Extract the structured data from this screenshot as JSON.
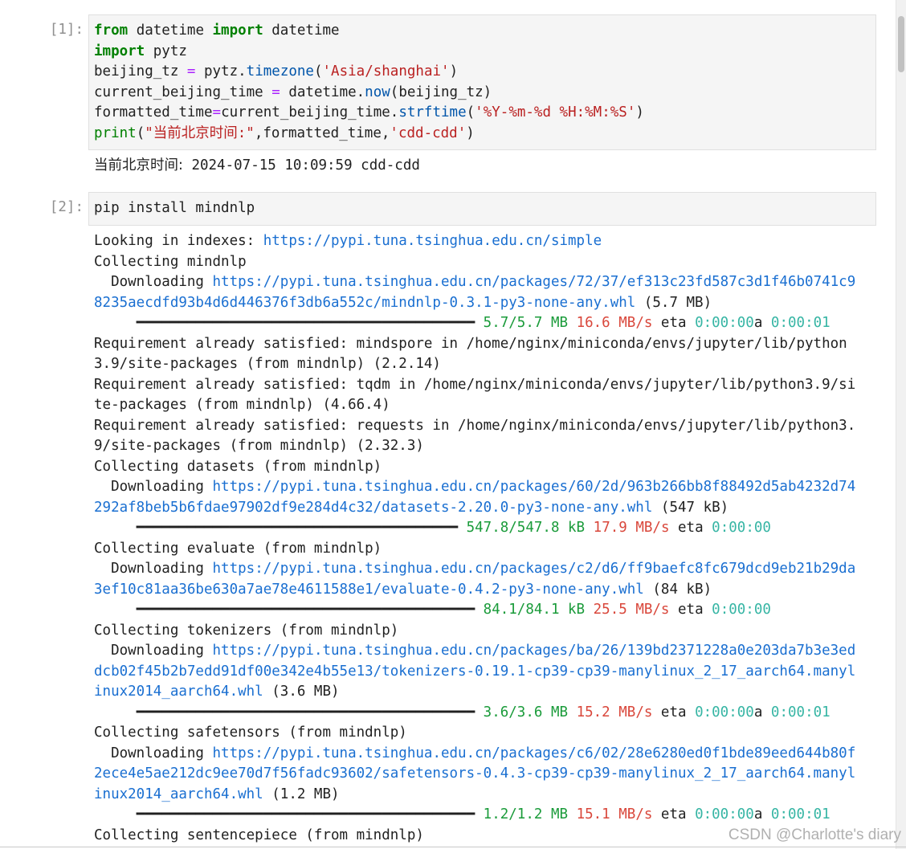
{
  "cells": [
    {
      "prompt": "[1]:",
      "code_lines": [
        [
          [
            "kw",
            "from"
          ],
          [
            "t",
            " datetime "
          ],
          [
            "kw",
            "import"
          ],
          [
            "t",
            " datetime"
          ]
        ],
        [
          [
            "kw",
            "import"
          ],
          [
            "t",
            " pytz"
          ]
        ],
        [
          [
            "t",
            "beijing_tz "
          ],
          [
            "op",
            "="
          ],
          [
            "t",
            " pytz."
          ],
          [
            "fn",
            "timezone"
          ],
          [
            "t",
            "("
          ],
          [
            "str",
            "'Asia/shanghai'"
          ],
          [
            "t",
            ")"
          ]
        ],
        [
          [
            "t",
            "current_beijing_time "
          ],
          [
            "op",
            "="
          ],
          [
            "t",
            " datetime."
          ],
          [
            "fn",
            "now"
          ],
          [
            "t",
            "(beijing_tz)"
          ]
        ],
        [
          [
            "t",
            "formatted_time"
          ],
          [
            "op",
            "="
          ],
          [
            "t",
            "current_beijing_time."
          ],
          [
            "fn",
            "strftime"
          ],
          [
            "t",
            "("
          ],
          [
            "str",
            "'%Y-%m-%d %H:%M:%S'"
          ],
          [
            "t",
            ")"
          ]
        ],
        [
          [
            "builtin",
            "print"
          ],
          [
            "t",
            "("
          ],
          [
            "str",
            "\"当前北京时间:\""
          ],
          [
            "t",
            ",formatted_time,"
          ],
          [
            "str",
            "'cdd-cdd'"
          ],
          [
            "t",
            ")"
          ]
        ]
      ],
      "output_lines": [
        [
          [
            "cjk",
            "当前北京时间:"
          ],
          [
            "t",
            " 2024-07-15 10:09:59 cdd-cdd"
          ]
        ]
      ]
    },
    {
      "prompt": "[2]:",
      "code_lines": [
        [
          [
            "t",
            "pip install mindnlp"
          ]
        ]
      ],
      "output_lines": [
        [
          [
            "t",
            "Looking in indexes: "
          ],
          [
            "link",
            "https://pypi.tuna.tsinghua.edu.cn/simple"
          ]
        ],
        [
          [
            "t",
            "Collecting mindnlp"
          ]
        ],
        [
          [
            "t",
            "  Downloading "
          ],
          [
            "link",
            "https://pypi.tuna.tsinghua.edu.cn/packages/72/37/ef313c23fd587c3d1f46b0741c9"
          ]
        ],
        [
          [
            "link",
            "8235aecdfd93b4d6d446376f3db6a552c/mindnlp-0.3.1-py3-none-any.whl"
          ],
          [
            "t",
            " (5.7 MB)"
          ]
        ],
        [
          [
            "bar",
            "     ━━━━━━━━━━━━━━━━━━━━━━━━━━━━━━━━━━━━━━━━ "
          ],
          [
            "green",
            "5.7/5.7 MB"
          ],
          [
            "t",
            " "
          ],
          [
            "red",
            "16.6 MB/s"
          ],
          [
            "t",
            " eta "
          ],
          [
            "cyan",
            "0:00:00"
          ],
          [
            "t",
            "a "
          ],
          [
            "cyan",
            "0:00:01"
          ]
        ],
        [
          [
            "t",
            "Requirement already satisfied: mindspore in /home/nginx/miniconda/envs/jupyter/lib/python"
          ]
        ],
        [
          [
            "t",
            "3.9/site-packages (from mindnlp) (2.2.14)"
          ]
        ],
        [
          [
            "t",
            "Requirement already satisfied: tqdm in /home/nginx/miniconda/envs/jupyter/lib/python3.9/si"
          ]
        ],
        [
          [
            "t",
            "te-packages (from mindnlp) (4.66.4)"
          ]
        ],
        [
          [
            "t",
            "Requirement already satisfied: requests in /home/nginx/miniconda/envs/jupyter/lib/python3."
          ]
        ],
        [
          [
            "t",
            "9/site-packages (from mindnlp) (2.32.3)"
          ]
        ],
        [
          [
            "t",
            "Collecting datasets (from mindnlp)"
          ]
        ],
        [
          [
            "t",
            "  Downloading "
          ],
          [
            "link",
            "https://pypi.tuna.tsinghua.edu.cn/packages/60/2d/963b266bb8f88492d5ab4232d74"
          ]
        ],
        [
          [
            "link",
            "292af8beb5b6fdae97902df9e284d4c32/datasets-2.20.0-py3-none-any.whl"
          ],
          [
            "t",
            " (547 kB)"
          ]
        ],
        [
          [
            "bar",
            "     ━━━━━━━━━━━━━━━━━━━━━━━━━━━━━━━━━━━━━━ "
          ],
          [
            "green",
            "547.8/547.8 kB"
          ],
          [
            "t",
            " "
          ],
          [
            "red",
            "17.9 MB/s"
          ],
          [
            "t",
            " eta "
          ],
          [
            "cyan",
            "0:00:00"
          ]
        ],
        [
          [
            "t",
            "Collecting evaluate (from mindnlp)"
          ]
        ],
        [
          [
            "t",
            "  Downloading "
          ],
          [
            "link",
            "https://pypi.tuna.tsinghua.edu.cn/packages/c2/d6/ff9baefc8fc679dcd9eb21b29da"
          ]
        ],
        [
          [
            "link",
            "3ef10c81aa36be630a7ae78e4611588e1/evaluate-0.4.2-py3-none-any.whl"
          ],
          [
            "t",
            " (84 kB)"
          ]
        ],
        [
          [
            "bar",
            "     ━━━━━━━━━━━━━━━━━━━━━━━━━━━━━━━━━━━━━━━━ "
          ],
          [
            "green",
            "84.1/84.1 kB"
          ],
          [
            "t",
            " "
          ],
          [
            "red",
            "25.5 MB/s"
          ],
          [
            "t",
            " eta "
          ],
          [
            "cyan",
            "0:00:00"
          ]
        ],
        [
          [
            "t",
            "Collecting tokenizers (from mindnlp)"
          ]
        ],
        [
          [
            "t",
            "  Downloading "
          ],
          [
            "link",
            "https://pypi.tuna.tsinghua.edu.cn/packages/ba/26/139bd2371228a0e203da7b3e3ed"
          ]
        ],
        [
          [
            "link",
            "dcb02f45b2b7edd91df00e342e4b55e13/tokenizers-0.19.1-cp39-cp39-manylinux_2_17_aarch64.manyl"
          ]
        ],
        [
          [
            "link",
            "inux2014_aarch64.whl"
          ],
          [
            "t",
            " (3.6 MB)"
          ]
        ],
        [
          [
            "bar",
            "     ━━━━━━━━━━━━━━━━━━━━━━━━━━━━━━━━━━━━━━━━ "
          ],
          [
            "green",
            "3.6/3.6 MB"
          ],
          [
            "t",
            " "
          ],
          [
            "red",
            "15.2 MB/s"
          ],
          [
            "t",
            " eta "
          ],
          [
            "cyan",
            "0:00:00"
          ],
          [
            "t",
            "a "
          ],
          [
            "cyan",
            "0:00:01"
          ]
        ],
        [
          [
            "t",
            "Collecting safetensors (from mindnlp)"
          ]
        ],
        [
          [
            "t",
            "  Downloading "
          ],
          [
            "link",
            "https://pypi.tuna.tsinghua.edu.cn/packages/c6/02/28e6280ed0f1bde89eed644b80f"
          ]
        ],
        [
          [
            "link",
            "2ece4e5ae212dc9ee70d7f56fadc93602/safetensors-0.4.3-cp39-cp39-manylinux_2_17_aarch64.manyl"
          ]
        ],
        [
          [
            "link",
            "inux2014_aarch64.whl"
          ],
          [
            "t",
            " (1.2 MB)"
          ]
        ],
        [
          [
            "bar",
            "     ━━━━━━━━━━━━━━━━━━━━━━━━━━━━━━━━━━━━━━━━ "
          ],
          [
            "green",
            "1.2/1.2 MB"
          ],
          [
            "t",
            " "
          ],
          [
            "red",
            "15.1 MB/s"
          ],
          [
            "t",
            " eta "
          ],
          [
            "cyan",
            "0:00:00"
          ],
          [
            "t",
            "a "
          ],
          [
            "cyan",
            "0:00:01"
          ]
        ],
        [
          [
            "t",
            "Collecting sentencepiece (from mindnlp)"
          ]
        ]
      ]
    }
  ],
  "watermark": "CSDN @Charlotte's diary",
  "colors": {
    "keyword": "#008000",
    "string": "#ba2121",
    "link": "#1a6fd1",
    "progress_done": "#1a9b3a",
    "speed": "#d9473b",
    "eta": "#36b5a4"
  }
}
